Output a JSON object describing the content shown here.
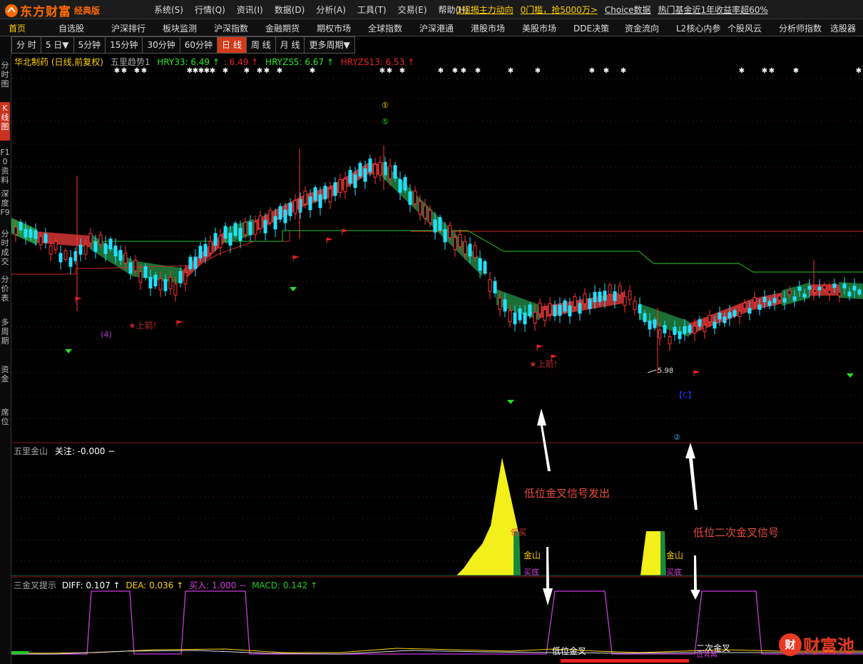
{
  "titlebar": {
    "logo_text": "东方财富",
    "logo_edition": "经典版",
    "menu": [
      "系统(S)",
      "行情(Q)",
      "资讯(I)",
      "数据(D)",
      "分析(A)",
      "工具(T)",
      "交易(E)",
      "帮助(H)"
    ],
    "promos": [
      "1招揭主力动向",
      "0门槛，抢5000万>",
      "Choice数据",
      "热门基金近1年收益率超60%"
    ]
  },
  "navbar": {
    "items": [
      "首页",
      "自选股",
      "沪深排行",
      "板块监测",
      "沪深指数",
      "金融期货",
      "期权市场",
      "全球指数",
      "沪深港通",
      "港股市场",
      "美股市场",
      "DDE决策",
      "资金流向",
      "L2核心内参",
      "个股风云",
      "分析师指数",
      "选股器"
    ]
  },
  "sidebar": {
    "items": [
      "分时图",
      "K线图",
      "F10资料",
      "深度F9",
      "分时成交",
      "分价表",
      "多周期",
      "资金",
      "席位"
    ]
  },
  "period_tabs": [
    "分 时",
    "5 日▼",
    "5分钟",
    "15分钟",
    "30分钟",
    "60分钟",
    "日 线",
    "周 线",
    "月 线",
    "更多周期▼"
  ],
  "main_chart": {
    "stock_name": "华北制药 (日线,前复权)",
    "indicator_name": "五里趋势1",
    "hry33": "HRY33: 6.49 ↑",
    "hry33b": ": 6.49 ↑",
    "hryzs5": "HRYZS5: 6.67 ↑",
    "hryzs13": "HRYZS13: 6.53 ↑",
    "low_label": "5.98",
    "marks": [
      "①",
      "⑤",
      "(4)",
      "★上箭!",
      "★上箭!",
      "【C】",
      "②"
    ]
  },
  "indicator1": {
    "name": "五里金山",
    "value": "关注: -0.000 −",
    "labels": [
      "低买",
      "金山",
      "买底",
      "金山",
      "买底"
    ]
  },
  "indicator2": {
    "name": "三金叉提示",
    "diff": "DIFF: 0.107 ↑",
    "dea": "DEA: 0.036 ↑",
    "buy": "买入: 1.000 −",
    "macd": "MACD: 0.142 ↑",
    "labels": [
      "低位金叉",
      "二次金叉",
      "低背离"
    ]
  },
  "annotations": {
    "first": "低位金叉信号发出",
    "second": "低位二次金叉信号"
  },
  "watermark": {
    "icon_text": "财",
    "text": "财富池"
  }
}
